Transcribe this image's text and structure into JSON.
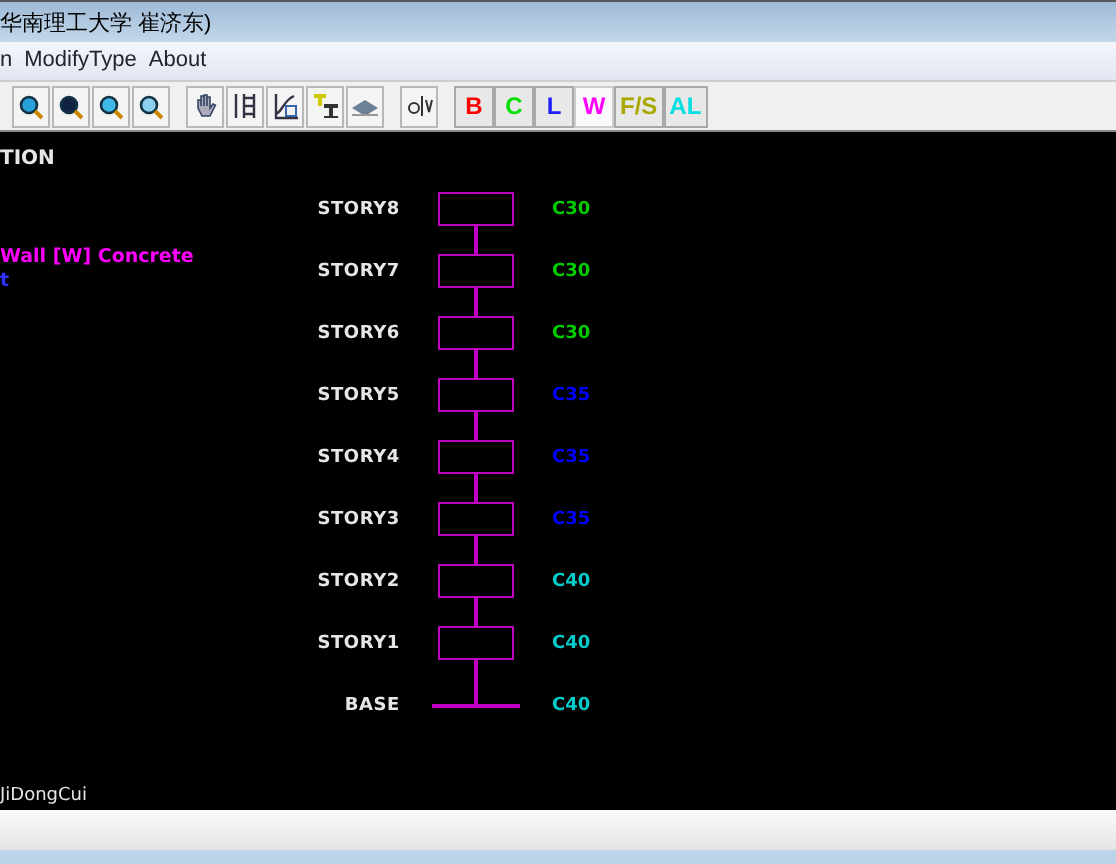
{
  "window": {
    "title": "华南理工大学 崔济东)"
  },
  "menu": [
    {
      "label": "n"
    },
    {
      "label": "ModifyType"
    },
    {
      "label": "About"
    }
  ],
  "filters": [
    {
      "label": "B",
      "color": "#ff0000",
      "selected": false
    },
    {
      "label": "C",
      "color": "#00e000",
      "selected": false
    },
    {
      "label": "L",
      "color": "#2020ff",
      "selected": false
    },
    {
      "label": "W",
      "color": "#ff00ff",
      "selected": true
    },
    {
      "label": "F/S",
      "color": "#a8a800",
      "selected": false
    },
    {
      "label": "AL",
      "color": "#00e0e0",
      "selected": false
    }
  ],
  "canvas": {
    "heading": "TION",
    "legend": [
      {
        "text": "Wall [W] Concrete",
        "color": "#ff00ff"
      },
      {
        "text": "t",
        "color": "#3030ff"
      }
    ],
    "stories": [
      {
        "name": "STORY8",
        "kind": "story",
        "grade": "C30",
        "color": "#00cc00"
      },
      {
        "name": "STORY7",
        "kind": "story",
        "grade": "C30",
        "color": "#00cc00"
      },
      {
        "name": "STORY6",
        "kind": "story",
        "grade": "C30",
        "color": "#00cc00"
      },
      {
        "name": "STORY5",
        "kind": "story",
        "grade": "C35",
        "color": "#0000ff"
      },
      {
        "name": "STORY4",
        "kind": "story",
        "grade": "C35",
        "color": "#0000ff"
      },
      {
        "name": "STORY3",
        "kind": "story",
        "grade": "C35",
        "color": "#0000ff"
      },
      {
        "name": "STORY2",
        "kind": "story",
        "grade": "C40",
        "color": "#00cccc"
      },
      {
        "name": "STORY1",
        "kind": "story",
        "grade": "C40",
        "color": "#00cccc"
      },
      {
        "name": "BASE",
        "kind": "base",
        "grade": "C40",
        "color": "#00cccc"
      }
    ],
    "author": "JiDongCui"
  }
}
